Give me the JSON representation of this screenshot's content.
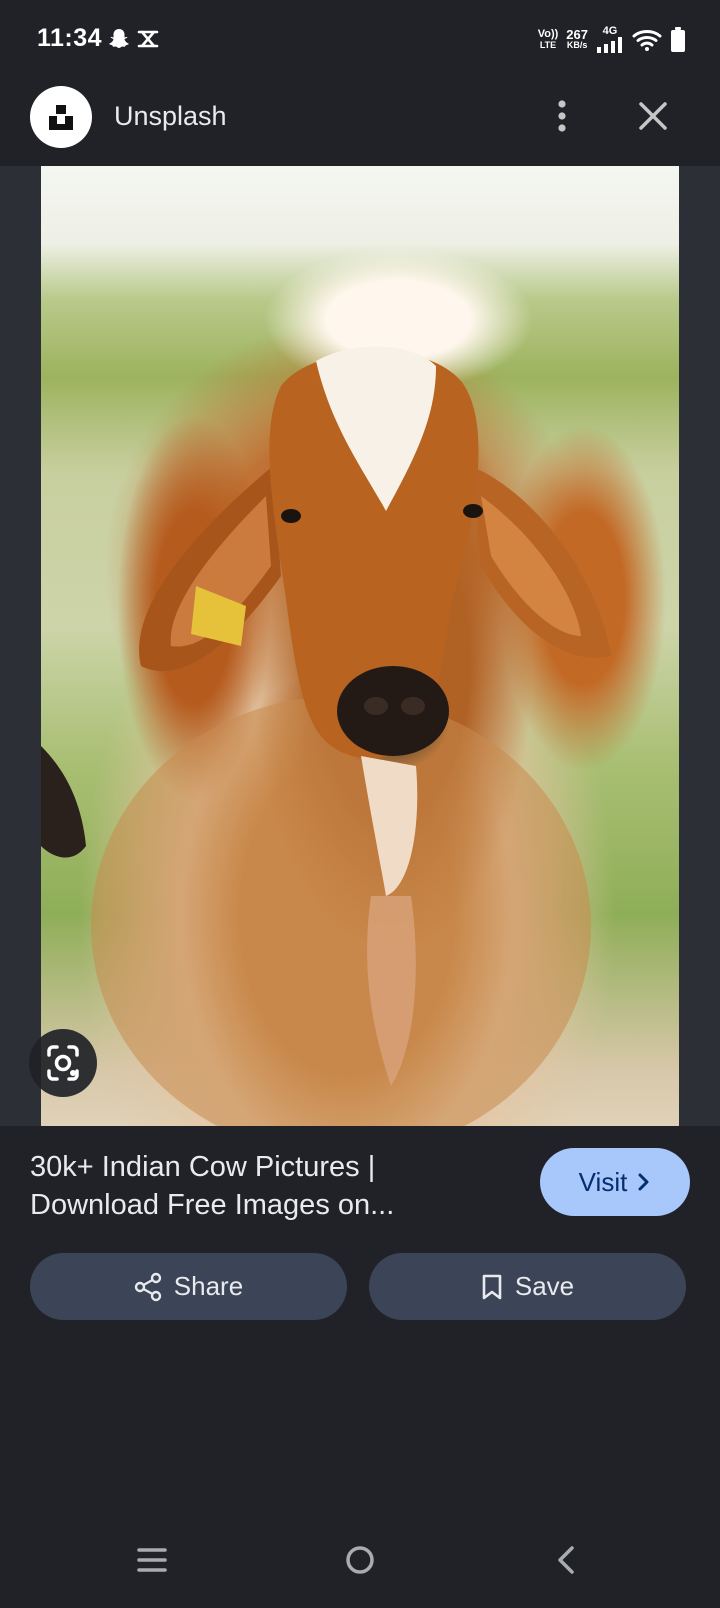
{
  "status_bar": {
    "time": "11:34",
    "network_type": "VoLTE",
    "network_type_line1": "Vo))",
    "network_type_line2": "LTE",
    "speed_value": "267",
    "speed_unit": "KB/s",
    "mobile_data": "4G",
    "icons": [
      "snapchat-icon",
      "notification-icon",
      "signal-icon",
      "wifi-icon",
      "battery-icon"
    ]
  },
  "header": {
    "site_name": "Unsplash",
    "logo_icon": "unsplash-logo",
    "more_icon": "more-vert-icon",
    "close_icon": "close-icon"
  },
  "image": {
    "lens_icon": "google-lens-icon"
  },
  "info": {
    "title_line1": "30k+ Indian Cow Pictures |",
    "title_line2": "Download Free Images on...",
    "visit_label": "Visit",
    "share_label": "Share",
    "save_label": "Save"
  },
  "nav_bar": {
    "menu_icon": "recent-apps-icon",
    "home_icon": "home-icon",
    "back_icon": "back-icon"
  },
  "colors": {
    "background": "#202227",
    "visit_button": "#a8c7fa",
    "action_button": "#3b4557"
  }
}
